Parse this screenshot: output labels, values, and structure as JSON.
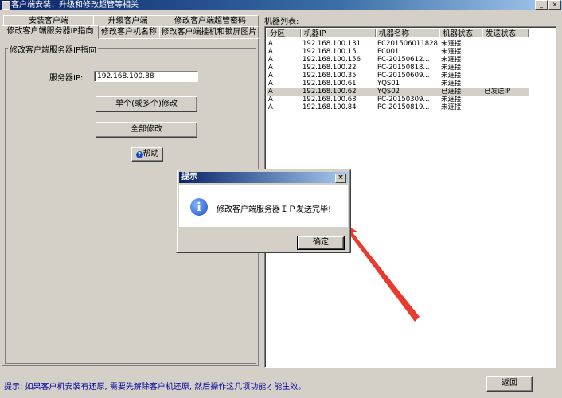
{
  "window": {
    "title": "客户端安装、升级和修改超管等相关",
    "minimize": "_",
    "close": "×"
  },
  "tabs": {
    "row1": [
      "安装客户端",
      "升级客户端",
      "修改客户端超管密码"
    ],
    "row2": [
      "修改客户端服务器IP指向",
      "修改客户机名称",
      "修改客户端挂机和锁屏图片"
    ]
  },
  "panel": {
    "group_title": "修改客户端服务器IP指向",
    "server_ip_label": "服务器IP:",
    "server_ip_value": "192.168.100.88",
    "single_modify_button": "单个(或多个)修改",
    "all_modify_button": "全部修改",
    "help_button": "帮助"
  },
  "machine_list": {
    "label": "机器列表:",
    "columns": [
      "分区",
      "机器IP",
      "机器名称",
      "机器状态",
      "发送状态"
    ],
    "rows": [
      [
        "A",
        "192.168.100.131",
        "PC201506011828",
        "未连接",
        ""
      ],
      [
        "A",
        "192.168.100.15",
        "PC001",
        "未连接",
        ""
      ],
      [
        "A",
        "192.168.100.156",
        "PC-20150612...",
        "未连接",
        ""
      ],
      [
        "A",
        "192.168.100.22",
        "PC-20150818...",
        "未连接",
        ""
      ],
      [
        "A",
        "192.168.100.35",
        "PC-20150609...",
        "未连接",
        ""
      ],
      [
        "A",
        "192.168.100.61",
        "YQS01",
        "未连接",
        ""
      ],
      [
        "A",
        "192.168.100.62",
        "YQS02",
        "已连接",
        "已发送IP"
      ],
      [
        "A",
        "192.168.100.68",
        "PC-20150309...",
        "未连接",
        ""
      ],
      [
        "A",
        "192.168.100.84",
        "PC-20150819...",
        "未连接",
        ""
      ]
    ],
    "selected_row": 6
  },
  "dialog": {
    "title": "提示",
    "message": "修改客户端服务器ＩＰ发送完毕!",
    "ok_button": "确定",
    "close": "×"
  },
  "status": {
    "hint": "提示: 如果客户机安装有还原, 需要先解除客户机还原, 然后操作这几项功能才能生效。",
    "back_button": "返回"
  },
  "colors": {
    "face": "#d4d0c8",
    "title_blue": "#0a246a",
    "hint_text": "#0000a0",
    "arrow": "#e83a2e"
  }
}
